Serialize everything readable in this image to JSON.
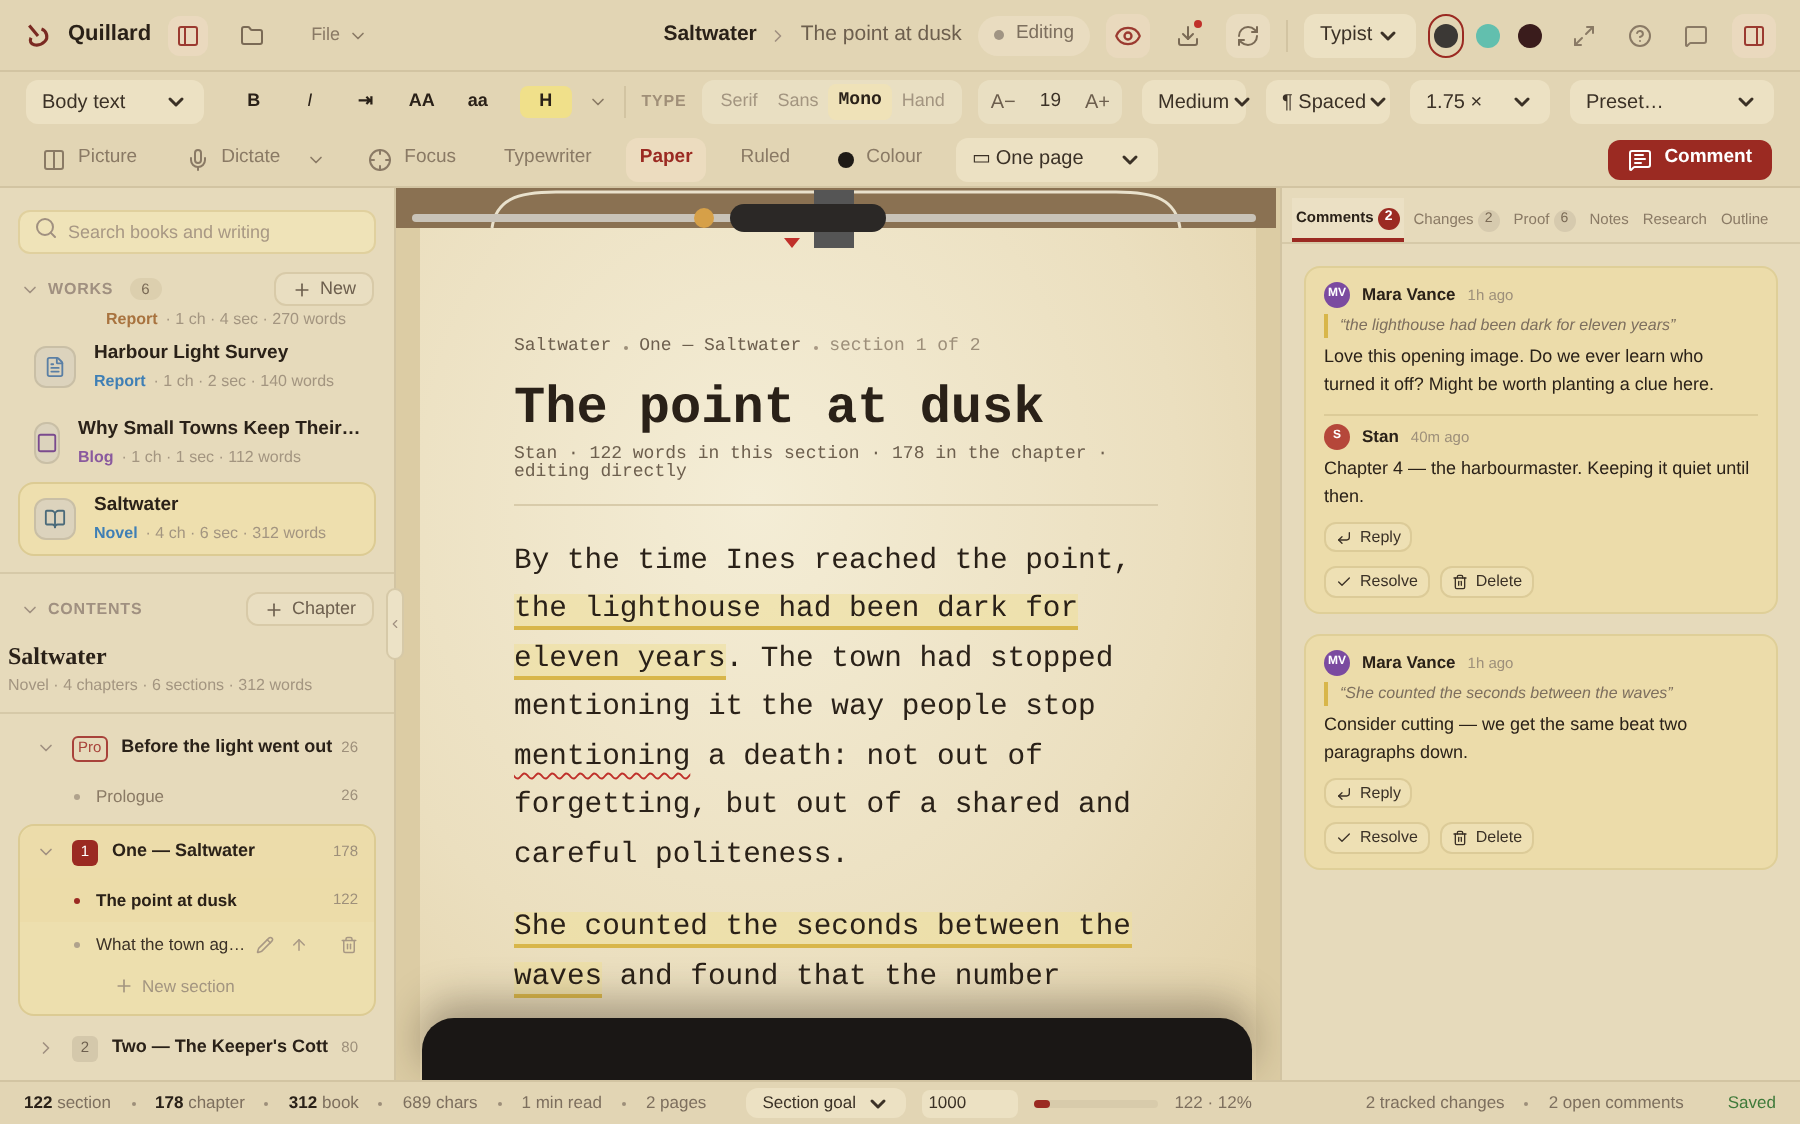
{
  "header": {
    "brand": "Quillard",
    "file_menu": "File",
    "document": "Saltwater",
    "section": "The point at dusk",
    "status": "Editing",
    "download_pending": true,
    "profile": "Typist",
    "swatches": [
      {
        "color": "#3b3835",
        "selected": true
      },
      {
        "color": "#62bfae",
        "selected": false
      },
      {
        "color": "#3a1c1c",
        "selected": false
      }
    ]
  },
  "format_bar": {
    "paragraph_style": "Body text",
    "buttons": [
      {
        "label": "B",
        "kind": "bold"
      },
      {
        "label": "I",
        "kind": "italic"
      },
      {
        "label": "⇥",
        "kind": "plain"
      },
      {
        "label": "AA",
        "kind": "plain"
      },
      {
        "label": "aa",
        "kind": "plain"
      },
      {
        "label": "H",
        "kind": "highlight"
      }
    ],
    "type_label": "TYPE",
    "fonts": [
      {
        "label": "Serif",
        "selected": false
      },
      {
        "label": "Sans",
        "selected": false
      },
      {
        "label": "Mono",
        "selected": true
      },
      {
        "label": "Hand",
        "selected": false
      }
    ],
    "size_down": "A−",
    "size": "19",
    "size_up": "A+",
    "weight": "Medium",
    "spacing": "¶ Spaced",
    "line_height": "1.75 ×",
    "preset": "Preset…"
  },
  "view_bar": {
    "items": [
      {
        "label": "Picture",
        "kind": "panel",
        "selected": false
      },
      {
        "label": "Dictate",
        "kind": "mic",
        "selected": false
      },
      {
        "label": "Focus",
        "kind": "focus",
        "selected": false
      },
      {
        "label": "Typewriter",
        "kind": "plain",
        "selected": false
      },
      {
        "label": "Paper",
        "kind": "plain",
        "selected": true
      },
      {
        "label": "Ruled",
        "kind": "plain",
        "selected": false
      },
      {
        "label": "Colour",
        "kind": "dot",
        "selected": false
      }
    ],
    "page_mode": "▭ One page",
    "comment_button": "Comment"
  },
  "sidebar": {
    "search_placeholder": "Search books and writing",
    "works_label": "WORKS",
    "works_count": "6",
    "new_button": "New",
    "works": [
      {
        "type": "Report",
        "meta": "· 1 ch · 4 sec · 270 words",
        "color": "#a8733f",
        "selected": false
      },
      {
        "title": "Harbour Light Survey",
        "type": "Report",
        "meta": "· 1 ch · 2 sec · 140 words",
        "color": "#3f7fb5",
        "kind": "doc",
        "selected": false
      },
      {
        "title": "Why Small Towns Keep Their…",
        "type": "Blog",
        "meta": "· 1 ch · 1 sec · 112 words",
        "color": "#8a5a9e",
        "kind": "blog",
        "selected": false
      },
      {
        "title": "Saltwater",
        "type": "Novel",
        "meta": "· 4 ch · 6 sec · 312 words",
        "color": "#3f7fb5",
        "kind": "book",
        "selected": true
      }
    ],
    "contents_label": "CONTENTS",
    "chapter_button": "Chapter",
    "book_title": "Saltwater",
    "book_meta": "Novel · 4 chapters · 6 sections · 312 words",
    "chapters": [
      {
        "badge": "Pro",
        "title": "Before the light went out",
        "count": "26",
        "expanded": true,
        "selected": false,
        "children": [
          {
            "title": "Prologue",
            "count": "26",
            "selected": false
          }
        ]
      },
      {
        "badge": "1",
        "title": "One — Saltwater",
        "count": "178",
        "expanded": true,
        "selected": true,
        "children": [
          {
            "title": "The point at dusk",
            "count": "122",
            "selected": true
          },
          {
            "title": "What the town ag…",
            "selected": false,
            "hovered": true
          }
        ],
        "add_label": "New section"
      },
      {
        "badge": "2",
        "title": "Two — The Keeper's Cott",
        "count": "80",
        "expanded": false,
        "selected": false
      }
    ]
  },
  "editor": {
    "crumbs": [
      "Saltwater",
      "One — Saltwater"
    ],
    "position": "section 1 of 2",
    "title": "The point at dusk",
    "byline": "Stan · 122 words in this section · 178 in the chapter · editing directly",
    "paragraphs": [
      [
        {
          "text": "By the time Ines reached the point, ",
          "kind": "plain"
        },
        {
          "text": "the lighthouse had been dark for eleven years",
          "kind": "comment"
        },
        {
          "text": ". The town had stopped mentioning it the way people stop ",
          "kind": "plain"
        },
        {
          "text": "mentioning",
          "kind": "spelling"
        },
        {
          "text": " a death: not out of forgetting, but out of a shared and careful politeness.",
          "kind": "plain"
        }
      ],
      [
        {
          "text": "She counted the seconds between the waves",
          "kind": "comment"
        },
        {
          "text": " and found that the number",
          "kind": "plain"
        }
      ]
    ]
  },
  "panel": {
    "tabs": [
      {
        "label": "Comments",
        "count": "2",
        "selected": true
      },
      {
        "label": "Changes",
        "count": "2",
        "selected": false
      },
      {
        "label": "Proof",
        "count": "6",
        "selected": false
      },
      {
        "label": "Notes",
        "selected": false
      },
      {
        "label": "Research",
        "selected": false
      },
      {
        "label": "Outline",
        "selected": false
      }
    ],
    "threads": [
      {
        "messages": [
          {
            "initials": "MV",
            "author": "Mara Vance",
            "time": "1h ago",
            "color": "#7b4aa0",
            "quote": "“the lighthouse had been dark for eleven years”",
            "text": "Love this opening image. Do we ever learn who turned it off? Might be worth planting a clue here."
          },
          {
            "initials": "S",
            "author": "Stan",
            "time": "40m ago",
            "color": "#b5473a",
            "text": "Chapter 4 — the harbourmaster. Keeping it quiet until then."
          }
        ],
        "reply": "Reply",
        "resolve": "Resolve",
        "delete": "Delete"
      },
      {
        "messages": [
          {
            "initials": "MV",
            "author": "Mara Vance",
            "time": "1h ago",
            "color": "#7b4aa0",
            "quote": "“She counted the seconds between the waves”",
            "text": "Consider cutting — we get the same beat two paragraphs down."
          }
        ],
        "reply": "Reply",
        "resolve": "Resolve",
        "delete": "Delete"
      }
    ]
  },
  "status_bar": {
    "counts": [
      {
        "value": "122",
        "label": "section"
      },
      {
        "value": "178",
        "label": "chapter"
      },
      {
        "value": "312",
        "label": "book"
      }
    ],
    "stats": [
      "689 chars",
      "1 min read",
      "2 pages"
    ],
    "goal_select": "Section goal",
    "goal": "1000",
    "goal_progress": {
      "level": 0.12
    },
    "goal_reading": "122 · 12%",
    "tracked": "2 tracked changes",
    "open_comments": "2 open comments",
    "saved": "Saved"
  }
}
